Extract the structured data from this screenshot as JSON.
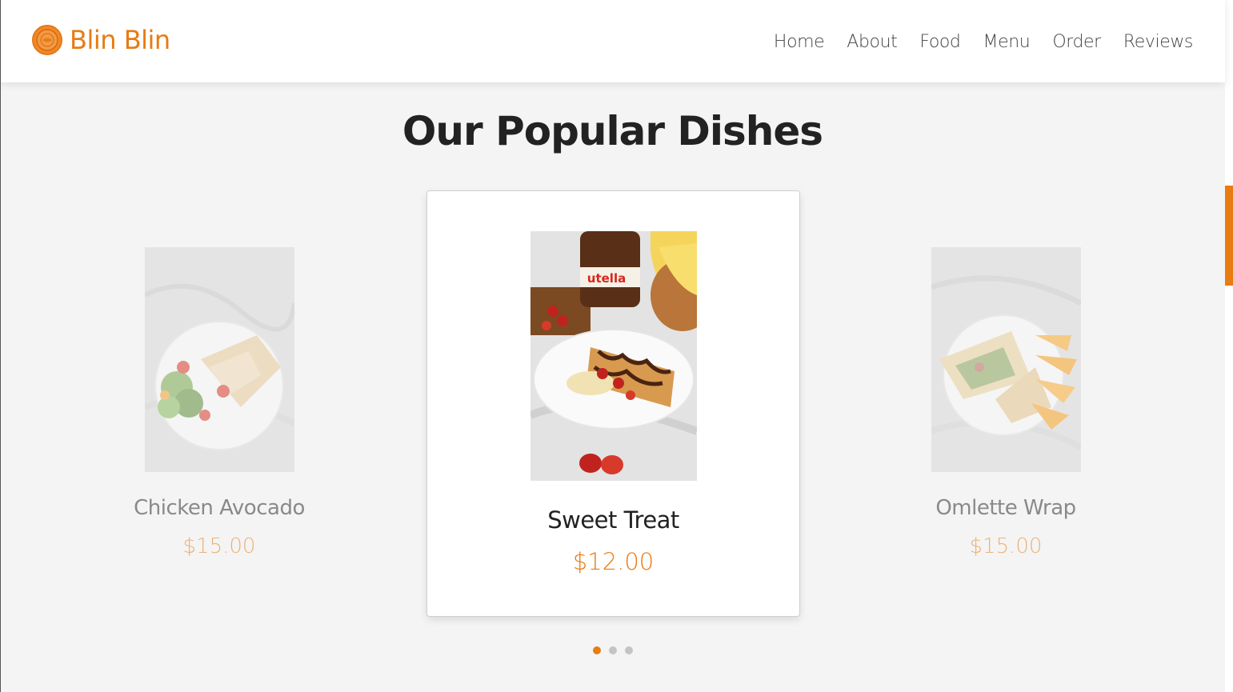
{
  "brand": {
    "name": "Blin Blin",
    "color": "#e87b12"
  },
  "nav": {
    "items": [
      {
        "label": "Home"
      },
      {
        "label": "About"
      },
      {
        "label": "Food"
      },
      {
        "label": "Menu"
      },
      {
        "label": "Order"
      },
      {
        "label": "Reviews"
      }
    ]
  },
  "section": {
    "title": "Our Popular Dishes"
  },
  "dishes": [
    {
      "name": "Chicken Avocado",
      "price": "$15.00",
      "photo": "chicken-avocado-wrap-with-salad-photo"
    },
    {
      "name": "Sweet Treat",
      "price": "$12.00",
      "photo": "nutella-banana-strawberry-crepe-photo"
    },
    {
      "name": "Omlette Wrap",
      "price": "$15.00",
      "photo": "omelette-wrap-with-orange-slices-photo"
    }
  ],
  "carousel": {
    "slide_count": 3,
    "active_index": 0
  },
  "colors": {
    "accent": "#e87b12",
    "page_bg": "#f4f4f4",
    "card_bg": "#ffffff"
  }
}
